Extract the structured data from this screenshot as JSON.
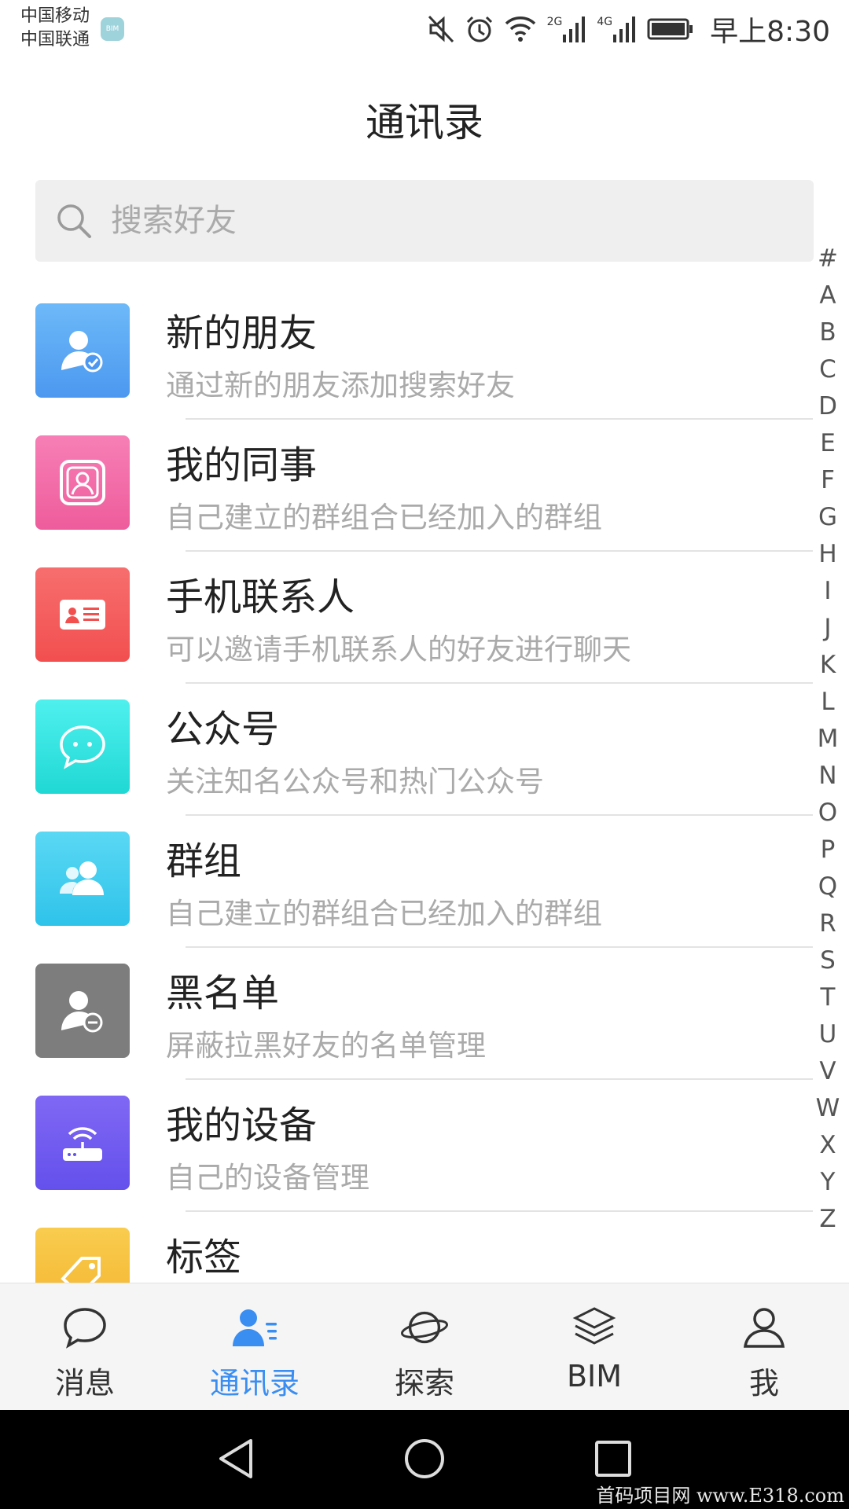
{
  "status_bar": {
    "carrier_1": "中国移动",
    "carrier_2": "中国联通",
    "carrier_badge": "BIM",
    "signal_1_label": "2G",
    "signal_2_label": "4G",
    "time": "早上8:30"
  },
  "header": {
    "title": "通讯录"
  },
  "search": {
    "placeholder": "搜索好友"
  },
  "contacts_menu": [
    {
      "title": "新的朋友",
      "subtitle": "通过新的朋友添加搜索好友",
      "icon": "new-friend-icon",
      "color": "#5aa8f5"
    },
    {
      "title": "我的同事",
      "subtitle": "自己建立的群组合已经加入的群组",
      "icon": "colleague-icon",
      "color": "#f26ea8"
    },
    {
      "title": "手机联系人",
      "subtitle": "可以邀请手机联系人的好友进行聊天",
      "icon": "contact-card-icon",
      "color": "#f55f5f"
    },
    {
      "title": "公众号",
      "subtitle": "关注知名公众号和热门公众号",
      "icon": "chat-bubble-icon",
      "color": "#2fe0de"
    },
    {
      "title": "群组",
      "subtitle": "自己建立的群组合已经加入的群组",
      "icon": "group-icon",
      "color": "#3fcdee"
    },
    {
      "title": "黑名单",
      "subtitle": "屏蔽拉黑好友的名单管理",
      "icon": "blocked-user-icon",
      "color": "#7a7a7a"
    },
    {
      "title": "我的设备",
      "subtitle": "自己的设备管理",
      "icon": "router-icon",
      "color": "#6f5cf0"
    },
    {
      "title": "标签",
      "subtitle": "",
      "icon": "tag-icon",
      "color": "#f7c13c"
    }
  ],
  "alphabet_index": [
    "#",
    "A",
    "B",
    "C",
    "D",
    "E",
    "F",
    "G",
    "H",
    "I",
    "J",
    "K",
    "L",
    "M",
    "N",
    "O",
    "P",
    "Q",
    "R",
    "S",
    "T",
    "U",
    "V",
    "W",
    "X",
    "Y",
    "Z"
  ],
  "tab_bar": {
    "tabs": [
      {
        "label": "消息",
        "icon": "message-bubble-icon",
        "active": false
      },
      {
        "label": "通讯录",
        "icon": "contacts-icon",
        "active": true
      },
      {
        "label": "探索",
        "icon": "planet-icon",
        "active": false
      },
      {
        "label": "BIM",
        "icon": "layers-icon",
        "active": false
      },
      {
        "label": "我",
        "icon": "person-icon",
        "active": false
      }
    ],
    "active_color": "#3a8ef2"
  },
  "watermark": "首码项目网 www.E318.com"
}
